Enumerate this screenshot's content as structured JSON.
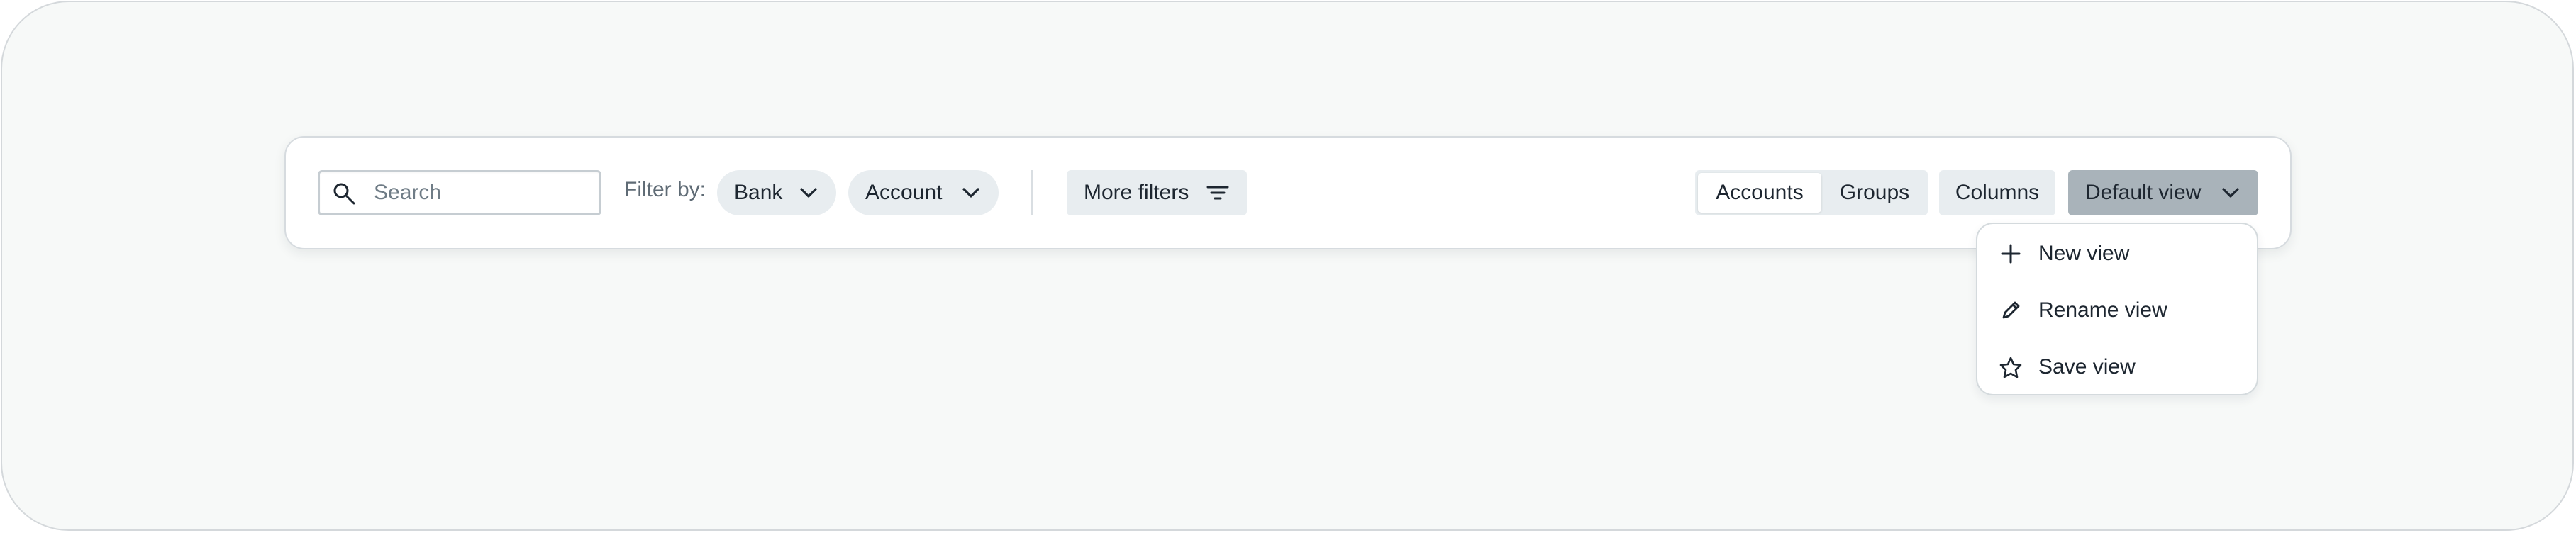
{
  "toolbar": {
    "search": {
      "placeholder": "Search",
      "value": ""
    },
    "filter_label": "Filter by:",
    "filters": [
      {
        "label": "Bank",
        "icon": "chevron-down-icon"
      },
      {
        "label": "Account",
        "icon": "chevron-down-icon"
      }
    ],
    "more_filters": {
      "label": "More filters",
      "icon": "filter-lines-icon"
    },
    "view_tabs": [
      {
        "label": "Accounts",
        "selected": true
      },
      {
        "label": "Groups",
        "selected": false
      }
    ],
    "columns_label": "Columns",
    "default_view": {
      "label": "Default view",
      "icon": "chevron-down-icon"
    }
  },
  "view_menu": {
    "items": [
      {
        "label": "New view",
        "icon": "plus-icon"
      },
      {
        "label": "Rename view",
        "icon": "pencil-icon"
      },
      {
        "label": "Save view",
        "icon": "star-icon"
      }
    ]
  },
  "colors": {
    "page_background": "#f7f9f8",
    "surface": "#ffffff",
    "border": "#d6dbdf",
    "control_background": "#e8edf0",
    "active_button": "#a9b3ba",
    "text": "#1d2630",
    "muted_text": "#5f6b75"
  }
}
